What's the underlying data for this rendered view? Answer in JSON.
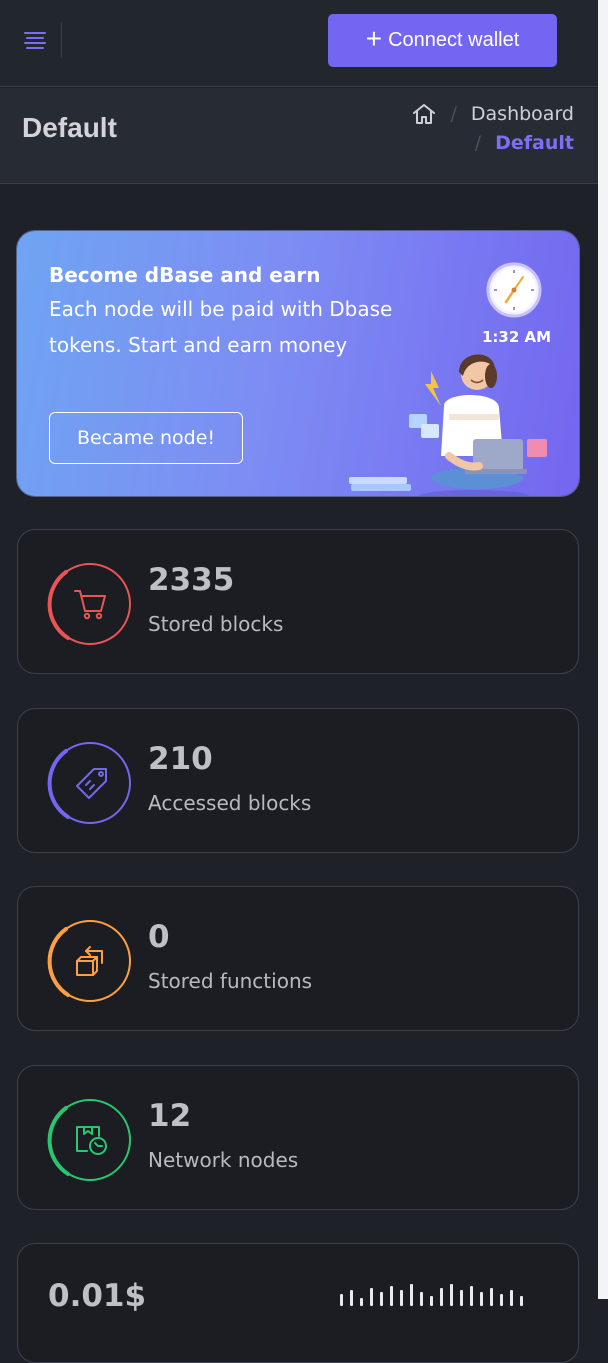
{
  "topbar": {
    "connect_label": "Connect wallet"
  },
  "header": {
    "title": "Default",
    "breadcrumb": {
      "parent": "Dashboard",
      "current": "Default",
      "separator": "/"
    }
  },
  "banner": {
    "title": "Become dBase and earn",
    "text": "Each node will be paid with Dbase tokens. Start and earn money",
    "button_label": "Became node!",
    "clock_time": "1:32 AM"
  },
  "stats": [
    {
      "value": "2335",
      "label": "Stored blocks",
      "color": "#ea5455",
      "icon": "cart-icon"
    },
    {
      "value": "210",
      "label": "Accessed blocks",
      "color": "#7367f0",
      "icon": "tag-icon"
    },
    {
      "value": "0",
      "label": "Stored functions",
      "color": "#ff9f43",
      "icon": "box-return-icon"
    },
    {
      "value": "12",
      "label": "Network nodes",
      "color": "#28c76f",
      "icon": "package-refresh-icon"
    }
  ],
  "price_card": {
    "value": "0.01$"
  },
  "colors": {
    "accent": "#7367f0",
    "background": "#1e2128"
  }
}
